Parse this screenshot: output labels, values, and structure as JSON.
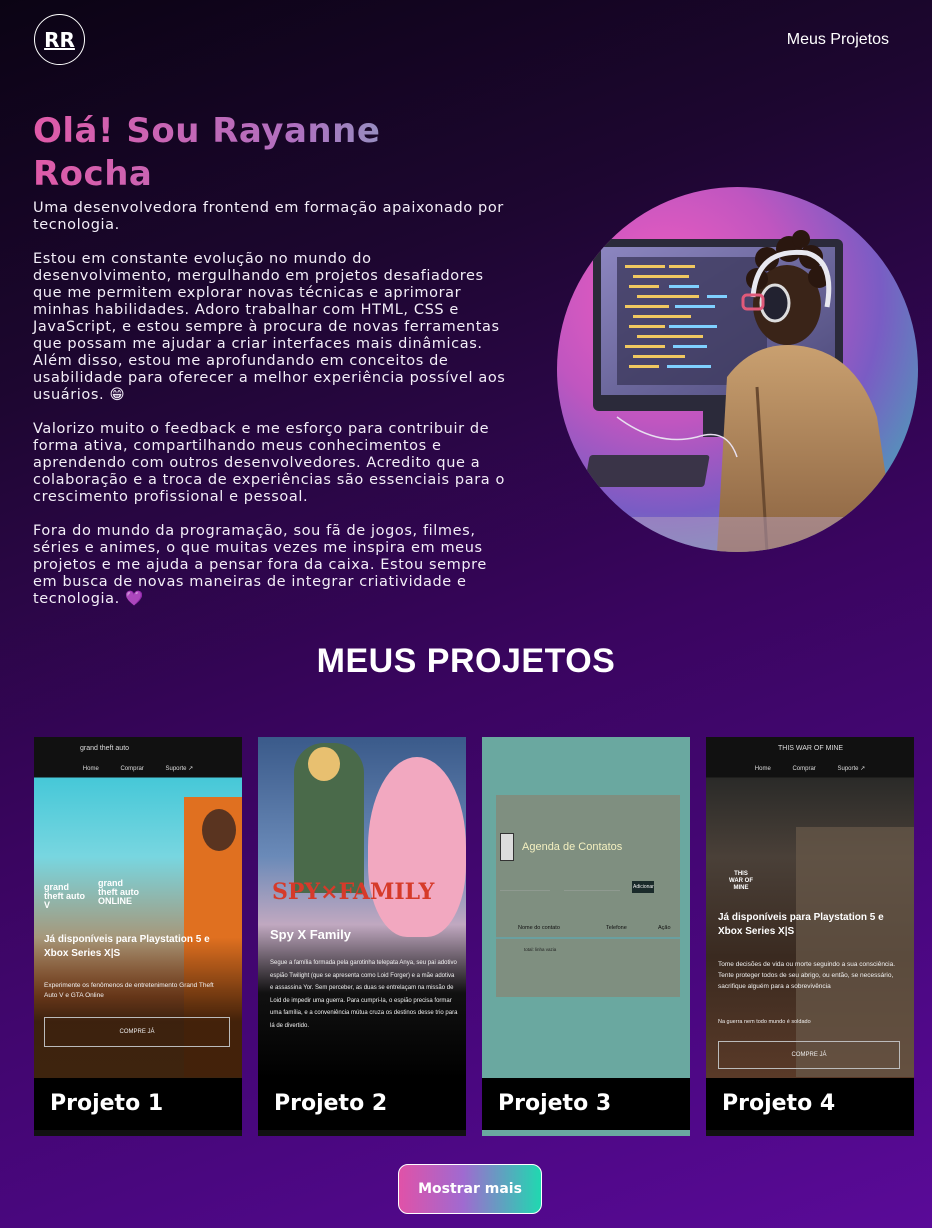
{
  "header": {
    "logo_text": "RR",
    "nav_link": "Meus Projetos"
  },
  "hero": {
    "title": "Olá! Sou Rayanne Rocha",
    "paragraphs": [
      "Uma desenvolvedora frontend em formação apaixonado por tecnologia.",
      "Estou em constante evolução no mundo do desenvolvimento, mergulhando em projetos desafiadores que me permitem explorar novas técnicas e aprimorar minhas habilidades. Adoro trabalhar com HTML, CSS e JavaScript, e estou sempre à procura de novas ferramentas que possam me ajudar a criar interfaces mais dinâmicas. Além disso, estou me aprofundando em conceitos de usabilidade para oferecer a melhor experiência possível aos usuários. 😁",
      "Valorizo muito o feedback e me esforço para contribuir de forma ativa, compartilhando meus conhecimentos e aprendendo com outros desenvolvedores. Acredito que a colaboração e a troca de experiências são essenciais para o crescimento profissional e pessoal.",
      "Fora do mundo da programação, sou fã de jogos, filmes, séries e animes, o que muitas vezes me inspira em meus projetos e me ajuda a pensar fora da caixa. Estou sempre em busca de novas maneiras de integrar criatividade e tecnologia. 💜"
    ]
  },
  "projects": {
    "section_title": "MEUS PROJETOS",
    "items": [
      {
        "label": "Projeto 1",
        "preview": {
          "brand": "grand theft auto",
          "nav": [
            "Home",
            "Comprar",
            "Suporte ↗"
          ],
          "logo_left": "grand theft auto V",
          "logo_right": "grand theft auto ONLINE",
          "headline": "Já disponíveis para Playstation 5 e Xbox Series X|S",
          "body": "Experimente os fenômenos de entretenimento Grand Theft Auto V e GTA Online",
          "button": "COMPRE JÁ"
        }
      },
      {
        "label": "Projeto 2",
        "preview": {
          "logo": "SPY×FAMILY",
          "headline": "Spy X Family",
          "body": "Segue a família formada pela garotinha telepata Anya, seu pai adotivo espião Twilight (que se apresenta como Loid Forger) e a mãe adotiva e assassina Yor. Sem perceber, as duas se entrelaçam na missão de Loid de impedir uma guerra. Para cumpri-la, o espião precisa formar uma família, e a conveniência mútua cruza os destinos desse trio para lá de divertido."
        }
      },
      {
        "label": "Projeto 3",
        "preview": {
          "title": "Agenda de Contatos",
          "button": "Adicionar",
          "columns": [
            "Nome do contato",
            "Telefone",
            "Ação"
          ],
          "empty_row": "total: linha vazia"
        }
      },
      {
        "label": "Projeto 4",
        "preview": {
          "brand": "THIS WAR OF MINE",
          "nav": [
            "Home",
            "Comprar",
            "Suporte ↗"
          ],
          "logo": "THIS WAR OF MINE",
          "headline": "Já disponíveis para Playstation 5 e Xbox Series X|S",
          "body": "Tome decisões de vida ou morte seguindo a sua consciência. Tente proteger todos de seu abrigo, ou então, se necessário, sacrifique alguém para a sobrevivência",
          "tagline": "Na guerra nem todo mundo é soldado",
          "button": "COMPRE JÁ"
        }
      }
    ],
    "more_button": "Mostrar mais"
  },
  "colors": {
    "accent_pink": "#e052a8",
    "accent_teal": "#20d8b0",
    "background": "#3a0560"
  }
}
